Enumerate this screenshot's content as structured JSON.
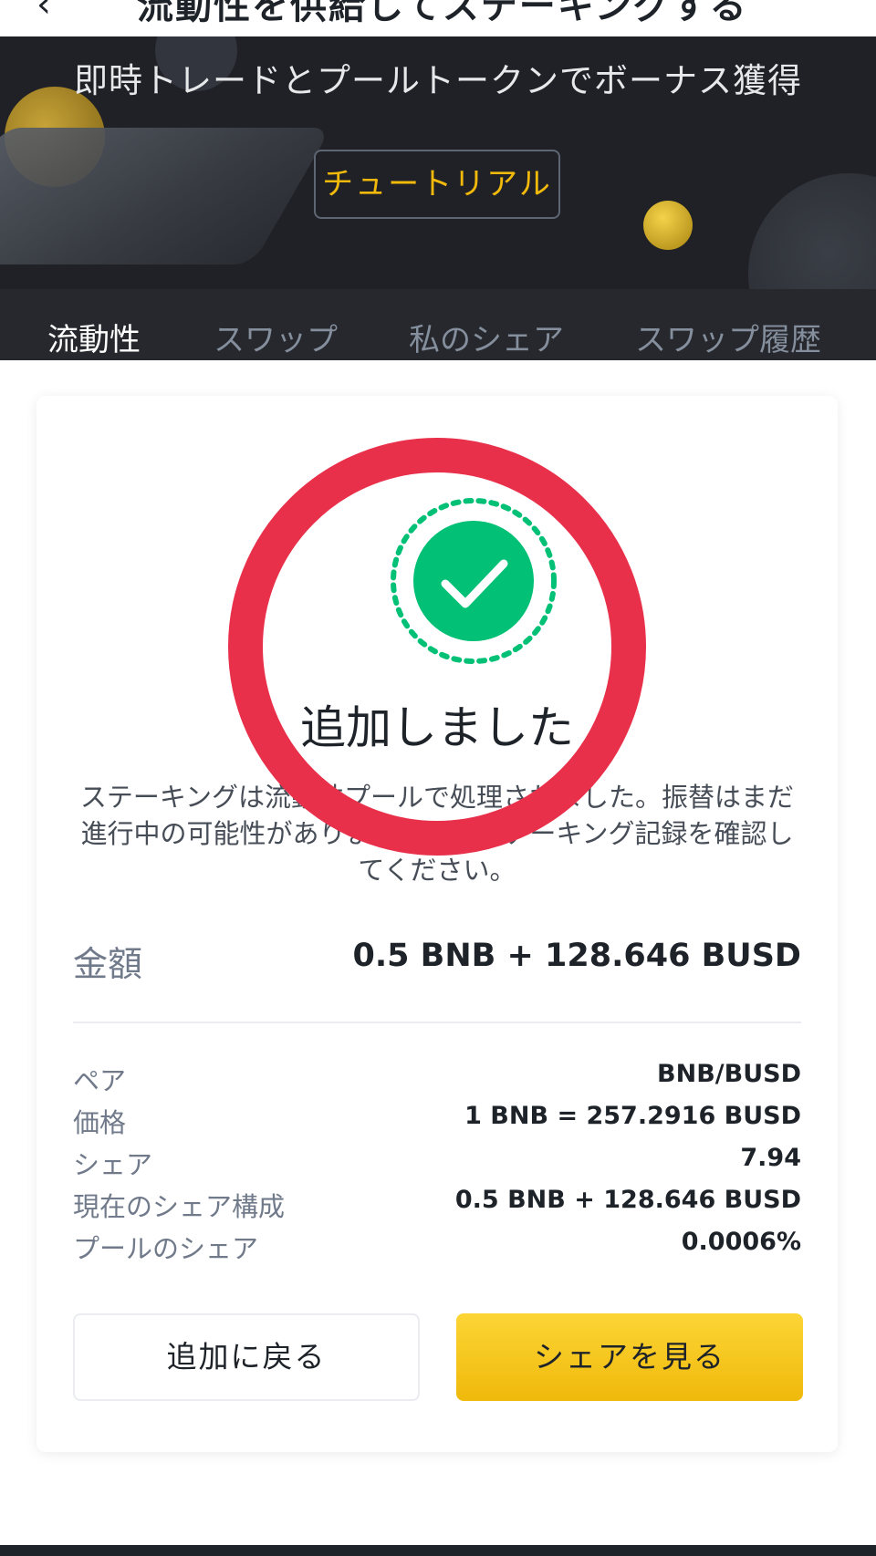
{
  "header": {
    "back_icon": "chevron-left-icon",
    "title": "流動性を供給してステーキングする"
  },
  "banner": {
    "headline": "即時トレードとプールトークンでボーナス獲得",
    "tutorial_label": "チュートリアル"
  },
  "tabs": [
    {
      "label": "流動性",
      "active": true
    },
    {
      "label": "スワップ",
      "active": false
    },
    {
      "label": "私のシェア",
      "active": false
    },
    {
      "label": "スワップ履歴",
      "active": false
    }
  ],
  "result": {
    "icon": "check-circle-icon",
    "title": "追加しました",
    "description": "ステーキングは流動性プールで処理されました。振替はまだ進行中の可能性がありますので、ステーキング記録を確認してください。",
    "amount_label": "金額",
    "amount_value": "0.5 BNB + 128.646 BUSD",
    "details": [
      {
        "label": "ペア",
        "value": "BNB/BUSD"
      },
      {
        "label": "価格",
        "value": "1 BNB = 257.2916 BUSD"
      },
      {
        "label": "シェア",
        "value": "7.94"
      },
      {
        "label": "現在のシェア構成",
        "value": "0.5 BNB + 128.646 BUSD"
      },
      {
        "label": "プールのシェア",
        "value": "0.0006%"
      }
    ],
    "back_button": "追加に戻る",
    "view_button": "シェアを見る"
  },
  "colors": {
    "accent": "#F0B90B",
    "success": "#02C076",
    "annotation_ring": "#E8304A",
    "banner_bg": "#1F2126"
  }
}
